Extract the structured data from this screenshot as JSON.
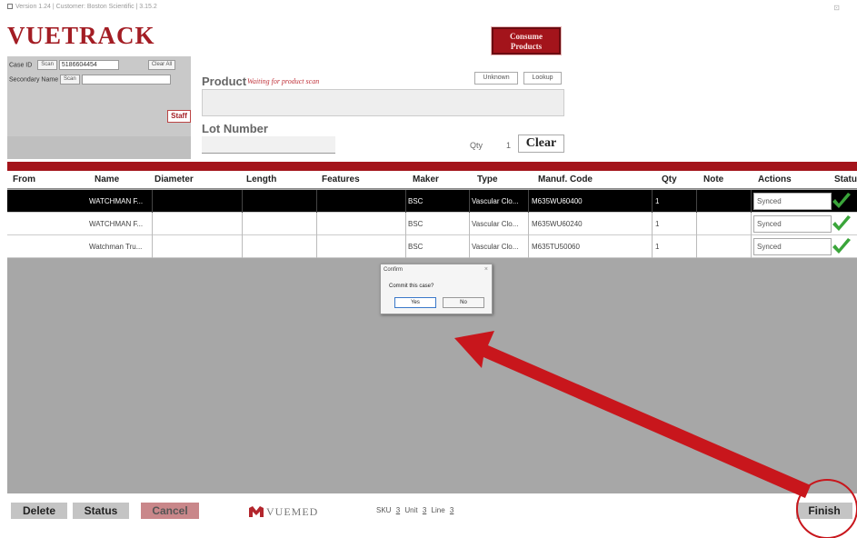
{
  "window": {
    "title": "Version 1.24 | Customer: Boston Scientific | 3.15.2",
    "controls": "⊡"
  },
  "app": {
    "logo": "VUETRACK",
    "footer_brand": "VUEMED"
  },
  "header": {
    "consume_button": "Consume Products"
  },
  "case_panel": {
    "case_id_label": "Case ID",
    "scan_label": "Scan",
    "case_id_value": "5186604454",
    "clear_all_label": "Clear All",
    "secondary_name_label": "Secondary Name",
    "scan_label2": "Scan",
    "secondary_name_value": "",
    "staff_label": "Staff"
  },
  "product_entry": {
    "product_label": "Product",
    "waiting_text": "Waiting for product scan",
    "unknown_label": "Unknown",
    "lookup_label": "Lookup",
    "lot_label": "Lot Number",
    "qty_label": "Qty",
    "qty_value": "1",
    "clear_label": "Clear"
  },
  "table": {
    "columns": [
      "From",
      "Name",
      "Diameter",
      "Length",
      "Features",
      "Maker",
      "Type",
      "Manuf. Code",
      "Qty",
      "Note",
      "Actions",
      "Status"
    ],
    "rows": [
      {
        "from": "",
        "name": "WATCHMAN F...",
        "diameter": "",
        "length": "",
        "features": "",
        "maker": "BSC",
        "type": "Vascular Clo...",
        "code": "M635WU60400",
        "qty": "1",
        "note": "",
        "action": "Synced",
        "selected": true
      },
      {
        "from": "",
        "name": "WATCHMAN F...",
        "diameter": "",
        "length": "",
        "features": "",
        "maker": "BSC",
        "type": "Vascular Clo...",
        "code": "M635WU60240",
        "qty": "1",
        "note": "",
        "action": "Synced",
        "selected": false
      },
      {
        "from": "",
        "name": "Watchman Tru...",
        "diameter": "",
        "length": "",
        "features": "",
        "maker": "BSC",
        "type": "Vascular Clo...",
        "code": "M635TU50060",
        "qty": "1",
        "note": "",
        "action": "Synced",
        "selected": false
      }
    ]
  },
  "dialog": {
    "title": "Confirm",
    "close": "×",
    "message": "Commit this case?",
    "yes": "Yes",
    "no": "No"
  },
  "footer": {
    "delete_label": "Delete",
    "status_label": "Status",
    "cancel_label": "Cancel",
    "sku_label": "SKU",
    "sku_value": "3",
    "unit_label": "Unit",
    "unit_value": "3",
    "line_label": "Line",
    "line_value": "3",
    "finish_label": "Finish"
  },
  "colors": {
    "brand_red": "#a3141b",
    "grid_bg": "#a7a7a7",
    "check_green": "#3aa53a",
    "annotation_red": "#c8161c"
  },
  "icons": [
    "window-icon",
    "vuemed-logo-icon",
    "checkmark-icon",
    "close-icon"
  ]
}
